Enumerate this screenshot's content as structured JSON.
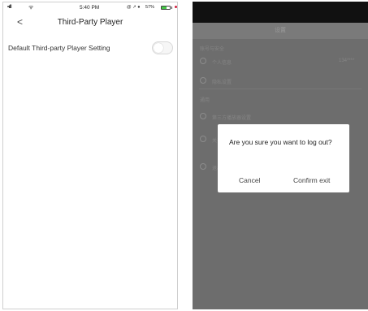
{
  "left_screen": {
    "status_bar": {
      "signal": "•ıll",
      "wifi": "ᯤ",
      "time": "5:40 PM",
      "icons": "@ ↗ ●",
      "battery_percent": "57%",
      "battery_level": 0.57
    },
    "nav": {
      "back_label": "<",
      "title": "Third-Party Player"
    },
    "setting": {
      "label": "Default Third-party Player Setting",
      "toggle_on": false
    }
  },
  "right_screen": {
    "header_title": "设置",
    "background_rows": [
      {
        "text": "账号与安全"
      },
      {
        "text": "个人信息",
        "value": "134****"
      },
      {
        "text": "隐私设置"
      },
      {
        "text": "通用"
      },
      {
        "text": "第三方播放器设置"
      },
      {
        "text": "关于我们"
      },
      {
        "text": "退出登录"
      }
    ],
    "dialog": {
      "message": "Are you sure you want to log out?",
      "cancel_label": "Cancel",
      "confirm_label": "Confirm exit"
    }
  }
}
